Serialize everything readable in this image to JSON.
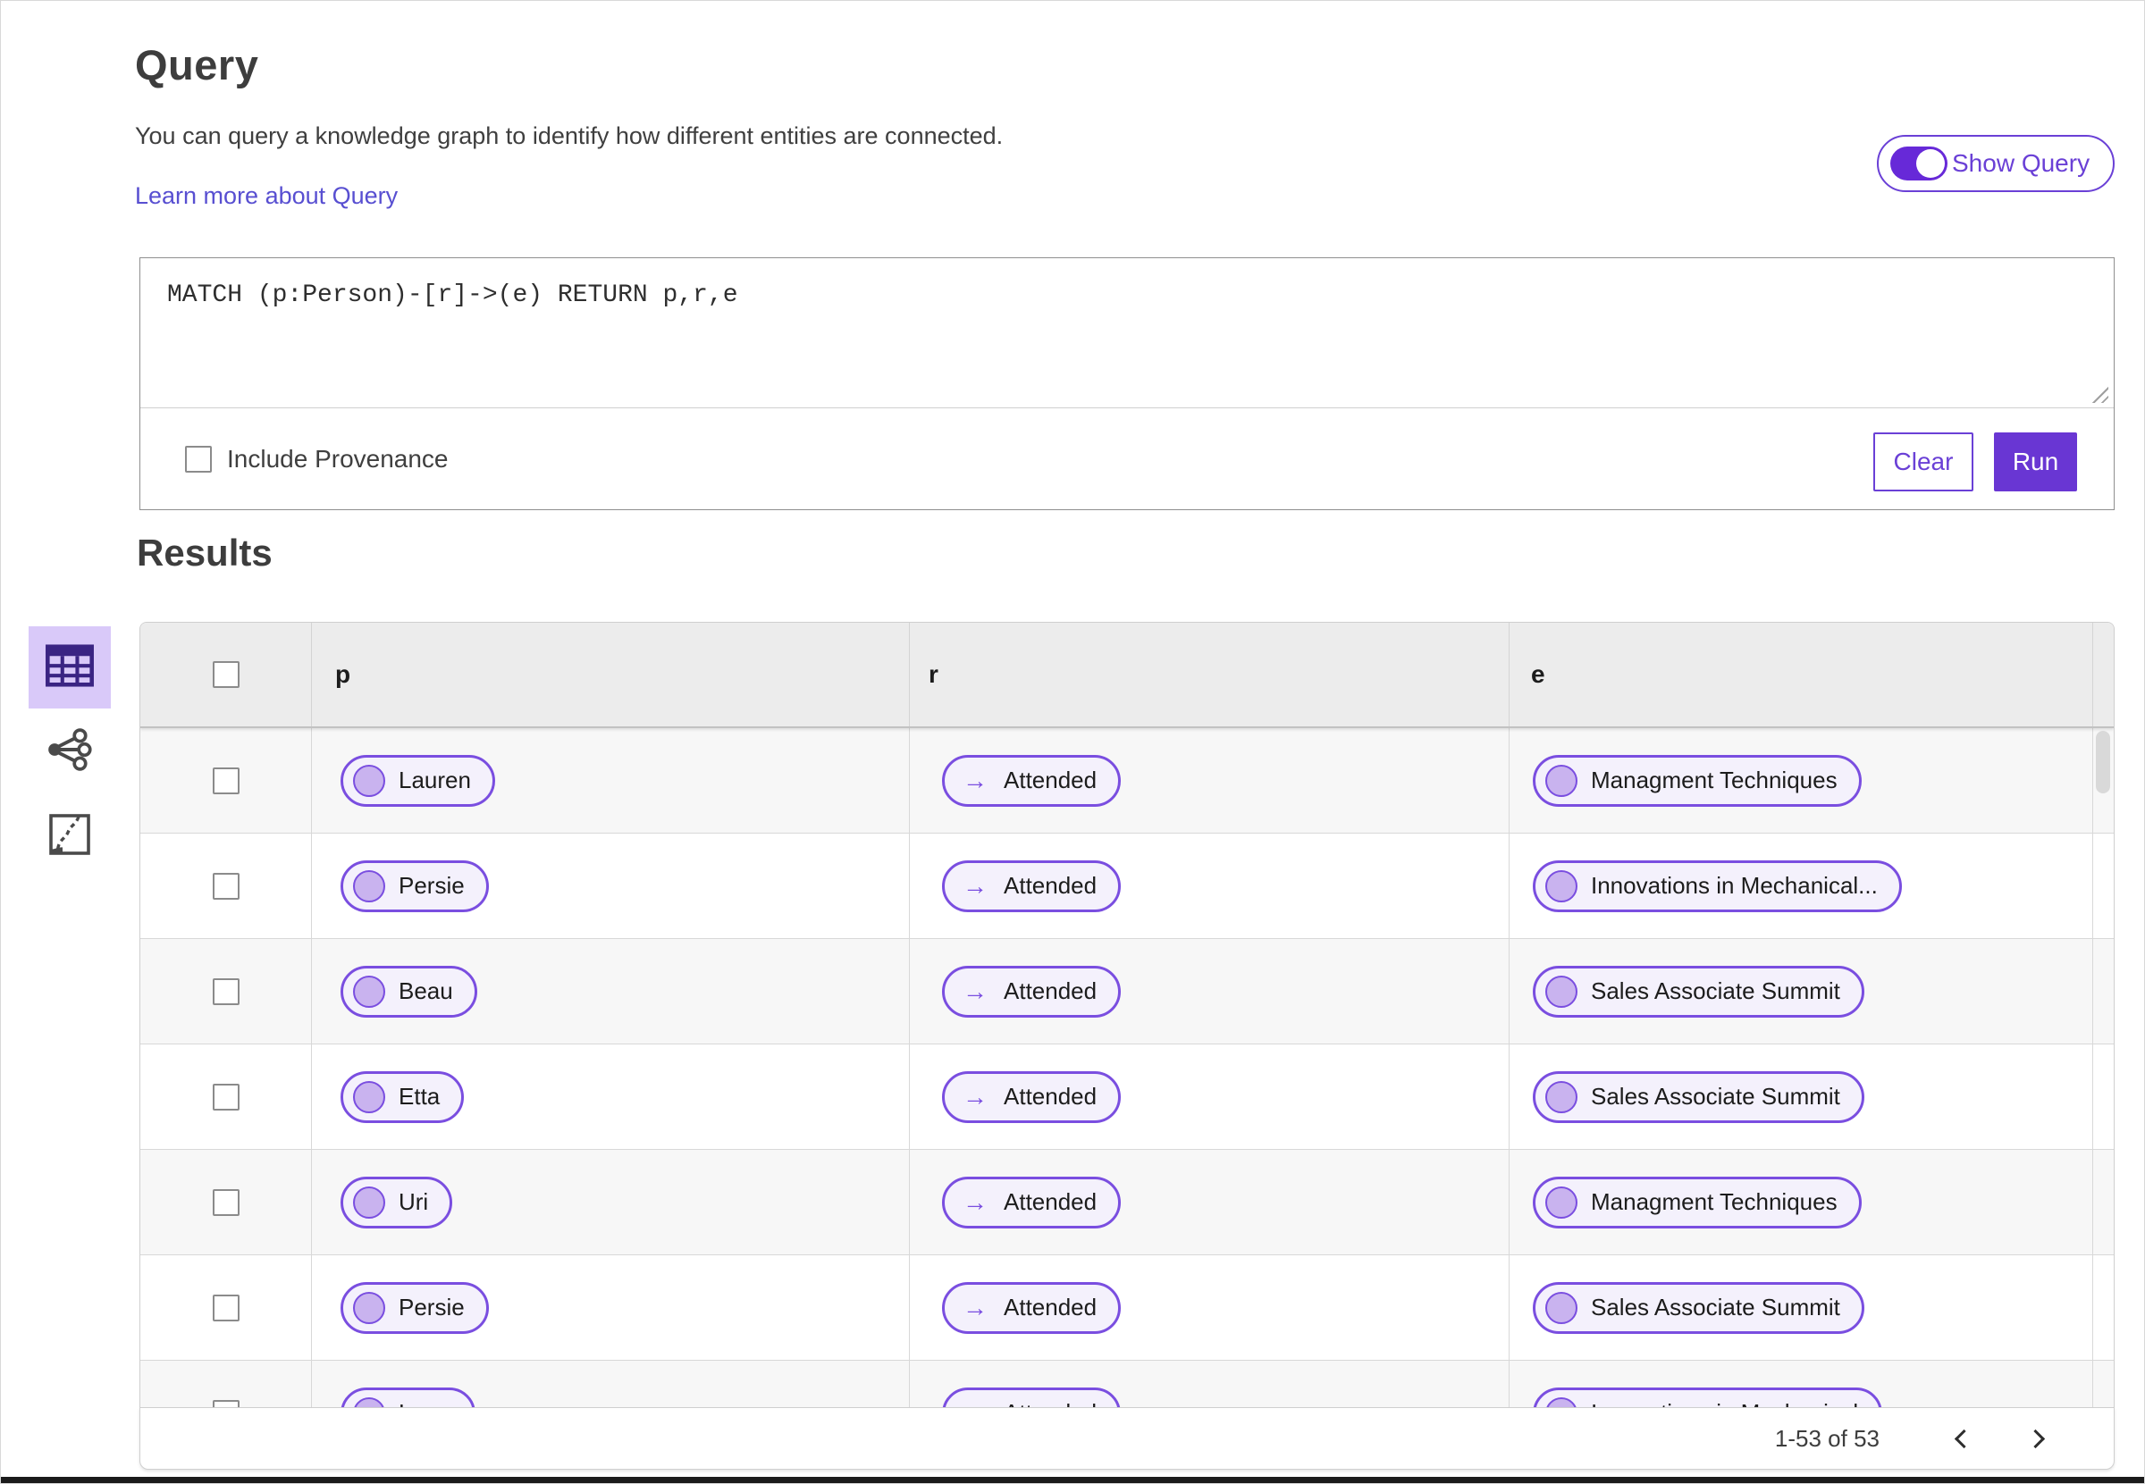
{
  "colors": {
    "accent": "#6936d3",
    "accent_outline": "#6a40d6",
    "pill_border": "#7a4ee0",
    "pill_bg": "#f4f1fc",
    "node_dot": "#c9b3ef",
    "selected_view_bg": "#d9c9f9",
    "link": "#584fd1",
    "header_row_bg": "#ececec",
    "row_alt_bg": "#f7f7f7"
  },
  "page": {
    "title": "Query",
    "description": "You can query a knowledge graph to identify how different entities are connected.",
    "learn_more_link": "Learn more about Query",
    "show_query_label": "Show Query",
    "show_query_on": true
  },
  "query_editor": {
    "query_text": "MATCH (p:Person)-[r]->(e) RETURN p,r,e",
    "include_provenance_label": "Include Provenance",
    "include_provenance_checked": false,
    "clear_button": "Clear",
    "run_button": "Run"
  },
  "results": {
    "title": "Results",
    "view_switcher": [
      {
        "icon": "table-view-icon",
        "selected": true
      },
      {
        "icon": "graph-view-icon",
        "selected": false
      },
      {
        "icon": "map-view-icon",
        "selected": false
      }
    ],
    "columns": [
      "p",
      "r",
      "e"
    ],
    "relation_arrow": "→",
    "rows": [
      {
        "p": "Lauren",
        "r": "Attended",
        "e": "Managment Techniques"
      },
      {
        "p": "Persie",
        "r": "Attended",
        "e": "Innovations in Mechanical..."
      },
      {
        "p": "Beau",
        "r": "Attended",
        "e": "Sales Associate Summit"
      },
      {
        "p": "Etta",
        "r": "Attended",
        "e": "Sales Associate Summit"
      },
      {
        "p": "Uri",
        "r": "Attended",
        "e": "Managment Techniques"
      },
      {
        "p": "Persie",
        "r": "Attended",
        "e": "Sales Associate Summit"
      },
      {
        "p": "Larry",
        "r": "Attended",
        "e": "Innovations in Mechanical"
      }
    ],
    "pagination": {
      "range_text": "1-53 of 53",
      "prev_icon": "chevron-left-icon",
      "next_icon": "chevron-right-icon"
    }
  }
}
